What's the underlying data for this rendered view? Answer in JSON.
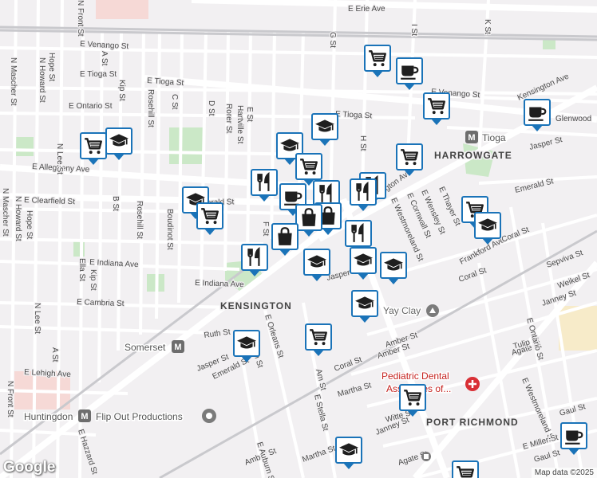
{
  "colors": {
    "marker_border": "#1a73b8",
    "marker_icon": "#1f1f1f",
    "background": "#f2f0f2",
    "road": "#ffffff",
    "park": "#cbe8c7",
    "rail": "#c9c9cd",
    "transit_icon": "#6d6d6d",
    "medical": "#d93036"
  },
  "streets": [
    "E Erie Ave",
    "E Venango St",
    "E Tioga St",
    "E Tioga St",
    "E Ontario St",
    "E Allegheny Ave",
    "E Clearfield St",
    "E Indiana Ave",
    "E Indiana Ave",
    "E Cambria St",
    "E Lehigh Ave",
    "E Venango St",
    "E Tioga St",
    "Glenwood",
    "Kensington Ave",
    "Kensington Ave",
    "Jasper St",
    "Jasper St",
    "Jasper St",
    "Emerald St",
    "Emerald St",
    "Frankford Ave",
    "Coral St",
    "Coral St",
    "Coral St",
    "Amber St",
    "Amber St",
    "Martha St",
    "Martha St",
    "Witte St",
    "Janney St",
    "Janney St",
    "Gaul St",
    "Gaul St",
    "Agate St",
    "Agate St",
    "Tulip St",
    "E Ontario St",
    "E Westmoreland St",
    "E Westmoreland St",
    "E Thayer St",
    "E Wensley St",
    "E Cornwall St",
    "N Front St",
    "N Front St",
    "N Mascher St",
    "N Mascher St",
    "N Howard St",
    "N Howard St",
    "N Lee St",
    "N Lee St",
    "Hope St",
    "Hope St",
    "A St",
    "A St",
    "B St",
    "Kip St",
    "Kip St",
    "Ella St",
    "Rosehill St",
    "Rosehill St",
    "Boudinot St",
    "C St",
    "D St",
    "Rorer St",
    "Hartville St",
    "E St",
    "F St",
    "G St",
    "H St",
    "I St",
    "K St",
    "E Orleans St",
    "E Birch St",
    "Ruth St",
    "Amber St",
    "E Auburn St",
    "Am St",
    "E Stella St",
    "E Hazzard St",
    "Weikel St",
    "Sepviva St",
    "E Miller St",
    "Emerald St"
  ],
  "areas": {
    "harrowgate": "HARROWGATE",
    "kensington": "KENSINGTON",
    "port_richmond": "PORT RICHMOND"
  },
  "transit": {
    "tioga": "Tioga",
    "somerset": "Somerset",
    "huntingdon": "Huntingdon",
    "transit_letter": "M"
  },
  "pois": {
    "yay_clay": "Yay Clay",
    "flip_out": "Flip Out Productions",
    "pediatric_1": "Pediatric Dental",
    "pediatric_2": "Associates of..."
  },
  "markers": [
    {
      "icon": "cart-icon"
    },
    {
      "icon": "coffee-icon"
    },
    {
      "icon": "cart-icon"
    },
    {
      "icon": "coffee-icon"
    },
    {
      "icon": "cap-icon"
    },
    {
      "icon": "cart-icon"
    },
    {
      "icon": "cap-icon"
    },
    {
      "icon": "cap-icon"
    },
    {
      "icon": "cart-icon"
    },
    {
      "icon": "cart-icon"
    },
    {
      "icon": "fork-icon"
    },
    {
      "icon": "cap-icon"
    },
    {
      "icon": "cart-icon"
    },
    {
      "icon": "coffee-icon"
    },
    {
      "icon": "fork-icon"
    },
    {
      "icon": "fork-icon"
    },
    {
      "icon": "fork-icon"
    },
    {
      "icon": "bag-icon"
    },
    {
      "icon": "bag-icon"
    },
    {
      "icon": "bag-icon"
    },
    {
      "icon": "fork-icon"
    },
    {
      "icon": "fork-icon"
    },
    {
      "icon": "cart-icon"
    },
    {
      "icon": "cap-icon"
    },
    {
      "icon": "cap-icon"
    },
    {
      "icon": "cap-icon"
    },
    {
      "icon": "cap-icon"
    },
    {
      "icon": "cap-icon"
    },
    {
      "icon": "cart-icon"
    },
    {
      "icon": "cap-icon"
    },
    {
      "icon": "cart-icon"
    },
    {
      "icon": "cap-icon"
    },
    {
      "icon": "cart-icon"
    },
    {
      "icon": "coffee-icon"
    }
  ],
  "branding": {
    "logo": "Google",
    "attribution": "Map data ©2025"
  }
}
